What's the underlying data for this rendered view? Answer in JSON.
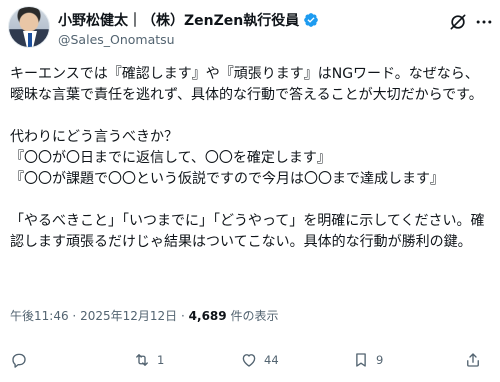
{
  "author": {
    "display_name": "小野松健太｜（株）ZenZen執行役員",
    "handle": "@Sales_Onomatsu",
    "verified_color": "#1d9bf0"
  },
  "post": {
    "paragraphs": [
      "キーエンスでは『確認します』や『頑張ります』はNGワード。なぜなら、曖昧な言葉で責任を逃れず、具体的な行動で答えることが大切だからです。",
      "代わりにどう言うべきか？\n『〇〇が〇日までに返信して、〇〇を確定します』\n『〇〇が課題で〇〇という仮説ですので今月は〇〇まで達成します』",
      "「やるべきこと」「いつまでに」「どうやって」を明確に示してください。確認します頑張るだけじゃ結果はついてこない。具体的な行動が勝利の鍵。"
    ],
    "time": "午後11:46",
    "separator": "·",
    "date": "2025年12月12日",
    "views_count": "4,689",
    "views_label": "件の表示"
  },
  "actions": {
    "reply_count": "",
    "retweet_count": "1",
    "like_count": "44",
    "bookmark_count": "9"
  },
  "icons": [
    "grok-icon",
    "more-icon",
    "verified-badge-icon",
    "reply-icon",
    "retweet-icon",
    "like-icon",
    "bookmark-icon",
    "share-icon"
  ],
  "colors": {
    "text": "#0f1419",
    "secondary": "#536471",
    "accent": "#1d9bf0"
  }
}
